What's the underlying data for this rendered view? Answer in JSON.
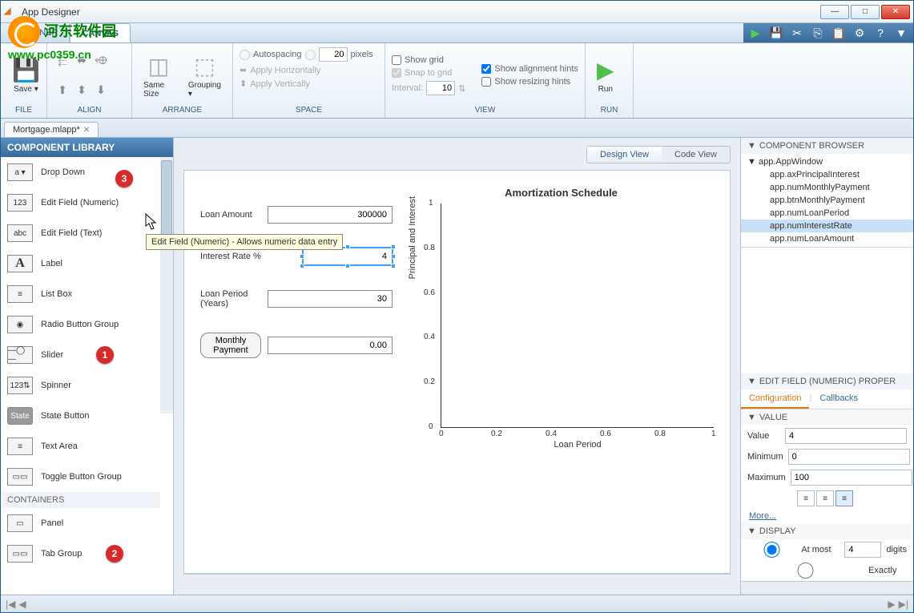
{
  "window": {
    "title": "App Designer"
  },
  "watermark": {
    "text": "河东软件园",
    "url": "www.pc0359.cn"
  },
  "toolstrip_tabs": {
    "designer": "DESIGNER",
    "canvas": "CANVAS"
  },
  "ribbon": {
    "file": {
      "label": "FILE",
      "save": "Save"
    },
    "align": {
      "label": "ALIGN"
    },
    "arrange": {
      "label": "ARRANGE",
      "same_size": "Same Size",
      "grouping": "Grouping"
    },
    "space": {
      "label": "SPACE",
      "autospacing": "Autospacing",
      "autospacing_value": "20",
      "pixels": "pixels",
      "apply_h": "Apply Horizontally",
      "apply_v": "Apply Vertically"
    },
    "view": {
      "label": "VIEW",
      "show_grid": "Show grid",
      "snap": "Snap to grid",
      "interval": "Interval:",
      "interval_value": "10",
      "align_hints": "Show alignment hints",
      "resize_hints": "Show resizing hints"
    },
    "run": {
      "label": "RUN",
      "run": "Run"
    }
  },
  "document": {
    "name": "Mortgage.mlapp*"
  },
  "component_library": {
    "title": "COMPONENT LIBRARY",
    "items": [
      {
        "label": "Drop Down",
        "icon": "a ▾"
      },
      {
        "label": "Edit Field (Numeric)",
        "icon": "123"
      },
      {
        "label": "Edit Field (Text)",
        "icon": "abc"
      },
      {
        "label": "Label",
        "icon": "A"
      },
      {
        "label": "List Box",
        "icon": "≡"
      },
      {
        "label": "Radio Button Group",
        "icon": "◉"
      },
      {
        "label": "Slider",
        "icon": "—◯—"
      },
      {
        "label": "Spinner",
        "icon": "123⇅"
      },
      {
        "label": "State Button",
        "icon": "State"
      },
      {
        "label": "Text Area",
        "icon": "≡"
      },
      {
        "label": "Toggle Button Group",
        "icon": "▭▭"
      }
    ],
    "containers_label": "CONTAINERS",
    "containers": [
      {
        "label": "Panel",
        "icon": "▭"
      },
      {
        "label": "Tab Group",
        "icon": "▭▭"
      }
    ]
  },
  "tooltip": "Edit Field (Numeric) - Allows numeric data entry",
  "canvas_view": {
    "design": "Design View",
    "code": "Code View"
  },
  "form": {
    "loan_amount": {
      "label": "Loan Amount",
      "value": "300000"
    },
    "interest_rate": {
      "label": "Interest Rate %",
      "value": "4"
    },
    "loan_period": {
      "label": "Loan Period (Years)",
      "value": "30"
    },
    "monthly_payment": {
      "label": "Monthly Payment",
      "value": "0.00"
    }
  },
  "chart_data": {
    "type": "line",
    "title": "Amortization Schedule",
    "xlabel": "Loan Period",
    "ylabel": "Principal and Interest",
    "x_ticks": [
      "0",
      "0.2",
      "0.4",
      "0.6",
      "0.8",
      "1"
    ],
    "y_ticks": [
      "0",
      "0.2",
      "0.4",
      "0.6",
      "0.8",
      "1"
    ],
    "xlim": [
      0,
      1
    ],
    "ylim": [
      0,
      1
    ],
    "series": []
  },
  "browser": {
    "title": "COMPONENT BROWSER",
    "root": "app.AppWindow",
    "nodes": [
      "app.axPrincipalInterest",
      "app.numMonthlyPayment",
      "app.btnMonthlyPayment",
      "app.numLoanPeriod",
      "app.numInterestRate",
      "app.numLoanAmount"
    ],
    "selected": "app.numInterestRate"
  },
  "properties": {
    "title": "EDIT FIELD (NUMERIC) PROPER",
    "tabs": {
      "config": "Configuration",
      "callbacks": "Callbacks"
    },
    "value_section": "VALUE",
    "value": {
      "label": "Value",
      "val": "4"
    },
    "minimum": {
      "label": "Minimum",
      "val": "0"
    },
    "maximum": {
      "label": "Maximum",
      "val": "100"
    },
    "more": "More...",
    "display_section": "DISPLAY",
    "at_most": {
      "label": "At most",
      "val": "4",
      "unit": "digits"
    },
    "exactly": {
      "label": "Exactly"
    }
  }
}
